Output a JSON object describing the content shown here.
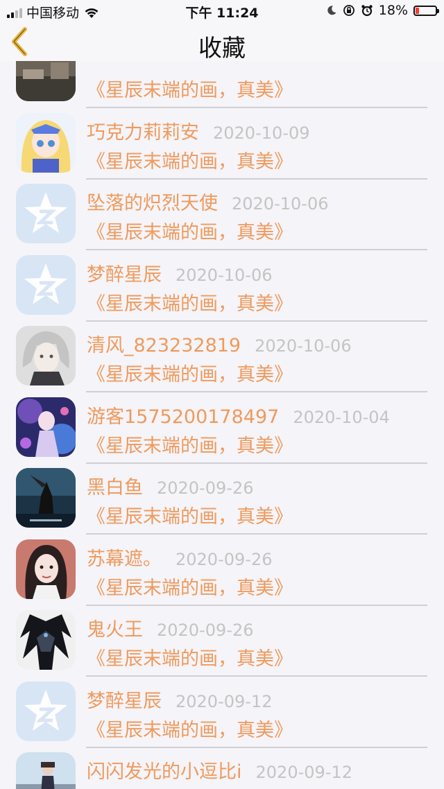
{
  "status_bar": {
    "carrier": "中国移动",
    "time": "下午 11:24",
    "battery_percent": "18%",
    "battery_level": 0.18,
    "battery_color": "#ff3b30",
    "icons": [
      "signal-icon",
      "wifi-icon",
      "moon-icon",
      "orientation-lock-icon",
      "alarm-icon",
      "battery-icon"
    ]
  },
  "nav": {
    "title": "收藏",
    "back_icon": "chevron-left-icon",
    "accent_color": "#e8b43a"
  },
  "colors": {
    "name": "#ef9a5d",
    "date": "#c4c4c4",
    "comment": "#ef9a5d",
    "divider": "#cfcfd4"
  },
  "items": [
    {
      "name": "",
      "date": "",
      "comment": "《星辰末端的画，真美》",
      "avatar": "photo-avatar"
    },
    {
      "name": "巧克力莉莉安",
      "date": "2020-10-09",
      "comment": "《星辰末端的画，真美》",
      "avatar": "anime-girl-avatar"
    },
    {
      "name": "坠落的炽烈天使",
      "date": "2020-10-06",
      "comment": "《星辰末端的画，真美》",
      "avatar": "default-star-avatar"
    },
    {
      "name": "梦醉星辰",
      "date": "2020-10-06",
      "comment": "《星辰末端的画，真美》",
      "avatar": "default-star-avatar"
    },
    {
      "name": "清风_823232819",
      "date": "2020-10-06",
      "comment": "《星辰末端的画，真美》",
      "avatar": "silver-hair-avatar"
    },
    {
      "name": "游客1575200178497",
      "date": "2020-10-04",
      "comment": "《星辰末端的画，真美》",
      "avatar": "purple-anime-avatar"
    },
    {
      "name": "黑白鱼",
      "date": "2020-09-26",
      "comment": "《星辰末端的画，真美》",
      "avatar": "game-character-avatar"
    },
    {
      "name": "苏幕遮。",
      "date": "2020-09-26",
      "comment": "《星辰末端的画，真美》",
      "avatar": "girl-photo-avatar"
    },
    {
      "name": "鬼火王",
      "date": "2020-09-26",
      "comment": "《星辰末端的画，真美》",
      "avatar": "dark-wings-avatar"
    },
    {
      "name": "梦醉星辰",
      "date": "2020-09-12",
      "comment": "《星辰末端的画，真美》",
      "avatar": "default-star-avatar"
    },
    {
      "name": "闪闪发光的小逗比i",
      "date": "2020-09-12",
      "comment": "《星辰末端的画，真美》",
      "avatar": "snow-photo-avatar"
    }
  ]
}
